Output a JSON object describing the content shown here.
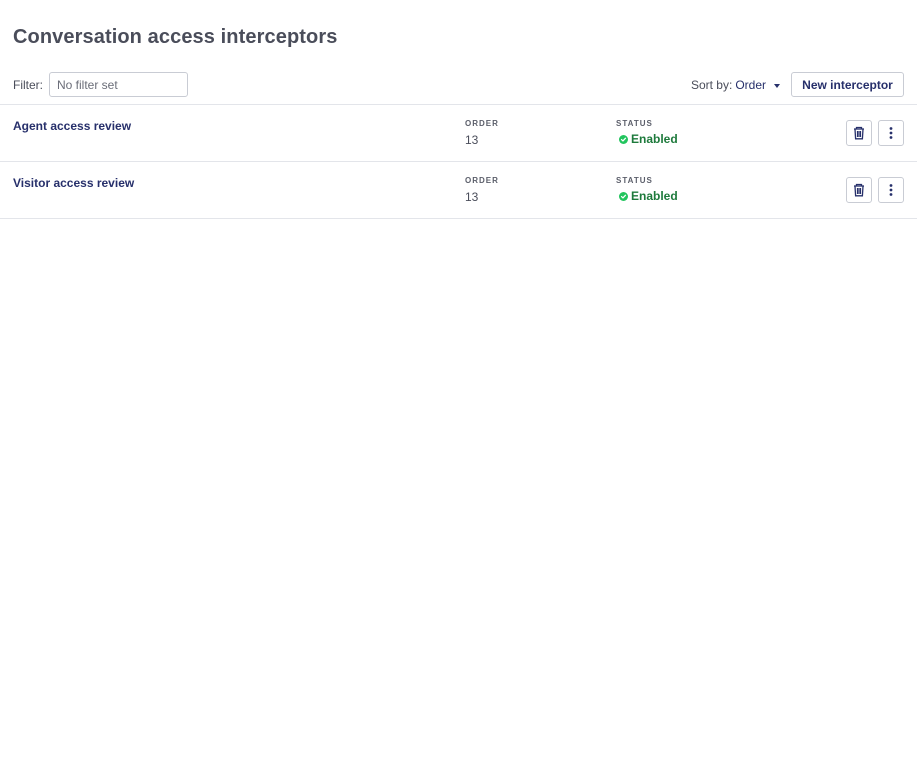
{
  "page": {
    "title": "Conversation access interceptors"
  },
  "toolbar": {
    "filter_label": "Filter:",
    "filter_placeholder": "No filter set",
    "filter_value": "",
    "sort_label": "Sort by:",
    "sort_value": "Order",
    "new_button_label": "New interceptor"
  },
  "columns": {
    "order_label": "ORDER",
    "status_label": "STATUS"
  },
  "rows": [
    {
      "name": "Agent access review",
      "order": "13",
      "status": "Enabled"
    },
    {
      "name": "Visitor access review",
      "order": "13",
      "status": "Enabled"
    }
  ],
  "icons": {
    "status": "check-circle-icon",
    "delete": "trash-icon",
    "more": "kebab-menu-icon"
  },
  "colors": {
    "accent": "#27306b",
    "status_enabled": "#1e7a3c",
    "status_dot": "#22c55e",
    "border": "#c9ccd4"
  }
}
